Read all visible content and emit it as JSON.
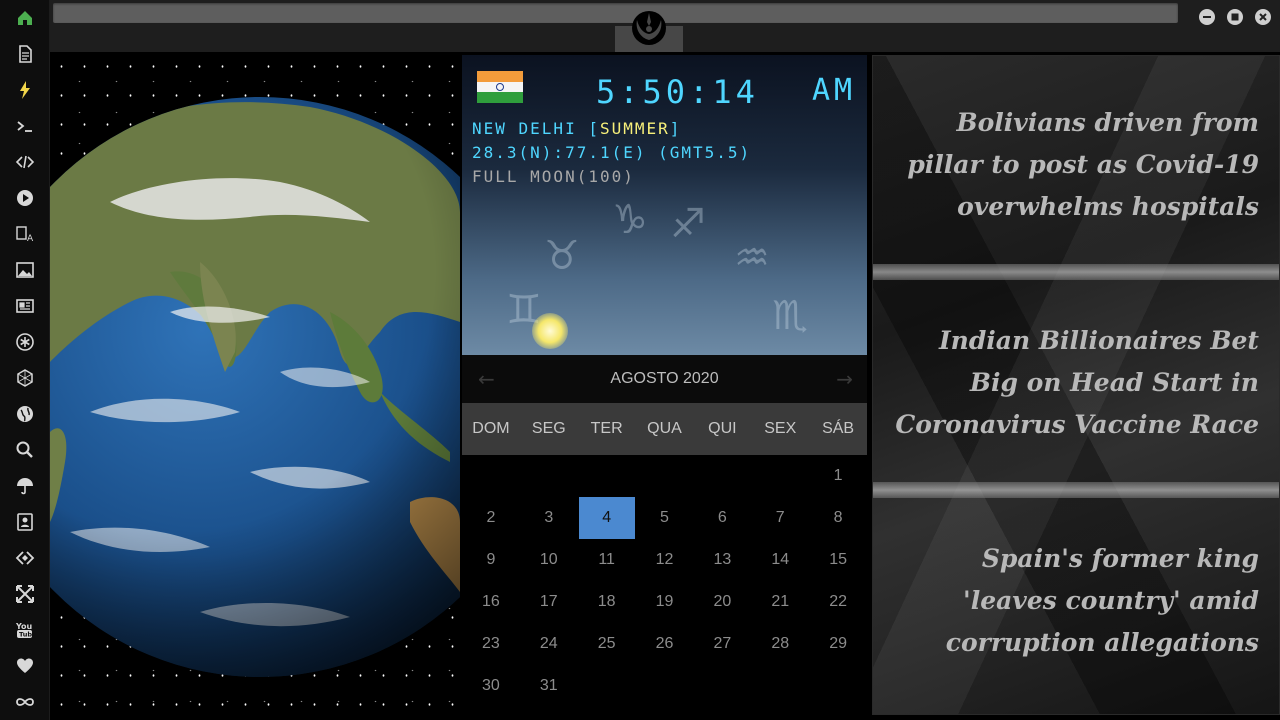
{
  "sidebar": {
    "items": [
      {
        "icon": "home-icon",
        "name": "sidebar-item-home",
        "active": true
      },
      {
        "icon": "document-icon",
        "name": "sidebar-item-document"
      },
      {
        "icon": "lightning-icon",
        "name": "sidebar-item-lightning"
      },
      {
        "icon": "terminal-icon",
        "name": "sidebar-item-terminal"
      },
      {
        "icon": "code-icon",
        "name": "sidebar-item-code"
      },
      {
        "icon": "play-icon",
        "name": "sidebar-item-play"
      },
      {
        "icon": "translate-icon",
        "name": "sidebar-item-translate"
      },
      {
        "icon": "image-icon",
        "name": "sidebar-item-image"
      },
      {
        "icon": "news-icon",
        "name": "sidebar-item-news"
      },
      {
        "icon": "asterisk-icon",
        "name": "sidebar-item-asterisk"
      },
      {
        "icon": "hexagon-icon",
        "name": "sidebar-item-hexagon"
      },
      {
        "icon": "globe-icon",
        "name": "sidebar-item-globe"
      },
      {
        "icon": "search-icon",
        "name": "sidebar-item-search"
      },
      {
        "icon": "umbrella-icon",
        "name": "sidebar-item-umbrella"
      },
      {
        "icon": "contacts-icon",
        "name": "sidebar-item-contacts"
      },
      {
        "icon": "code-brackets-icon",
        "name": "sidebar-item-brackets"
      },
      {
        "icon": "fullscreen-icon",
        "name": "sidebar-item-fullscreen"
      },
      {
        "icon": "youtube-icon",
        "name": "sidebar-item-youtube"
      },
      {
        "icon": "heart-icon",
        "name": "sidebar-item-heart"
      },
      {
        "icon": "infinity-icon",
        "name": "sidebar-item-infinity"
      }
    ],
    "active_color": "#4caf50",
    "icon_color": "#d8d8d8",
    "lightning_color": "#f2d64b"
  },
  "titlebar": {
    "logo_icon": "rebel-alliance-icon",
    "buttons": [
      "minimize-icon",
      "maximize-icon",
      "close-icon"
    ]
  },
  "clock": {
    "time": "5:50:14",
    "ampm": "AM",
    "location_city": "NEW DELHI [",
    "location_season": "SUMMER",
    "location_close": "]",
    "coords": "28.3(N):77.1(E) (GMT5.5)",
    "moon": "FULL MOON(100)",
    "flag_icon": "india-flag-icon"
  },
  "calendar": {
    "month_label": "AGOSTO 2020",
    "prev_icon": "arrow-left-icon",
    "next_icon": "arrow-right-icon",
    "weekdays": [
      "DOM",
      "SEG",
      "TER",
      "QUA",
      "QUI",
      "SEX",
      "SÁB"
    ],
    "leading_blanks": 6,
    "days": [
      "1",
      "2",
      "3",
      "4",
      "5",
      "6",
      "7",
      "8",
      "9",
      "10",
      "11",
      "12",
      "13",
      "14",
      "15",
      "16",
      "17",
      "18",
      "19",
      "20",
      "21",
      "22",
      "23",
      "24",
      "25",
      "26",
      "27",
      "28",
      "29",
      "30",
      "31"
    ],
    "today": "4",
    "today_color": "#4b89d0"
  },
  "news": {
    "headlines": [
      "Bolivians driven from pillar to post as Covid-19 overwhelms hospitals",
      "Indian Billionaires Bet Big on Head Start in Coronavirus Vaccine Race",
      "Spain's former king 'leaves country' amid corruption allegations"
    ]
  }
}
